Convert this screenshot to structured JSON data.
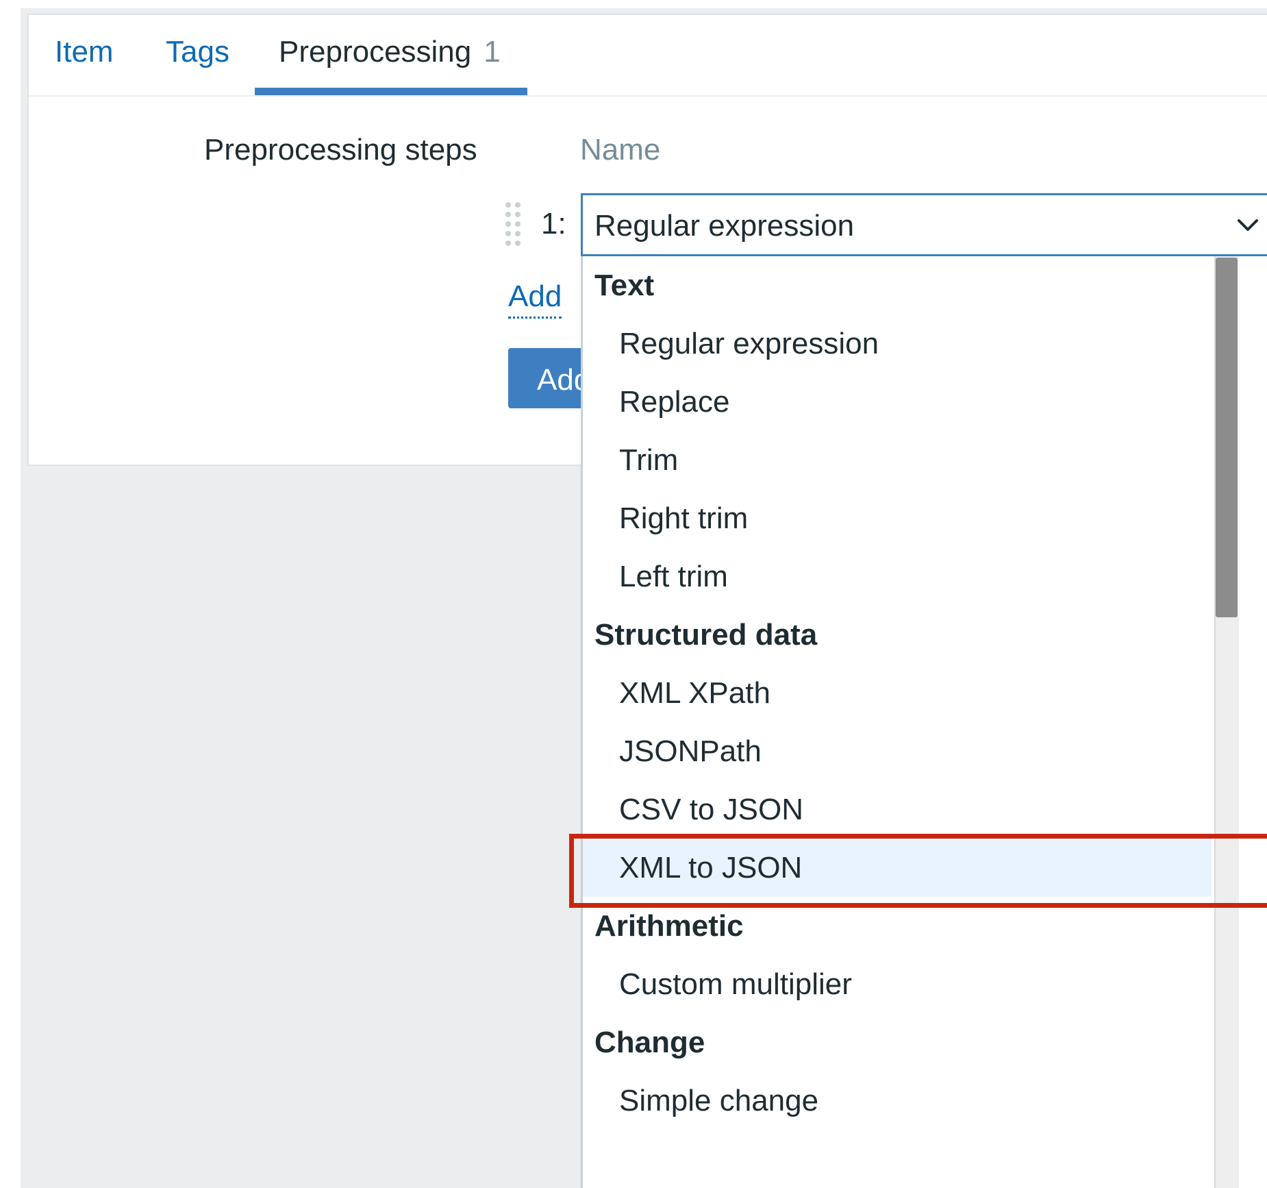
{
  "tabs": [
    {
      "label": "Item"
    },
    {
      "label": "Tags"
    },
    {
      "label": "Preprocessing",
      "count": "1"
    }
  ],
  "form": {
    "steps_label": "Preprocessing steps",
    "name_header": "Name",
    "step": {
      "number": "1:",
      "selected": "Regular expression"
    },
    "add_link": "Add",
    "add_button": "Add"
  },
  "dropdown": {
    "groups": [
      {
        "label": "Text",
        "options": [
          "Regular expression",
          "Replace",
          "Trim",
          "Right trim",
          "Left trim"
        ]
      },
      {
        "label": "Structured data",
        "options": [
          "XML XPath",
          "JSONPath",
          "CSV to JSON",
          "XML to JSON"
        ]
      },
      {
        "label": "Arithmetic",
        "options": [
          "Custom multiplier"
        ]
      },
      {
        "label": "Change",
        "options": [
          "Simple change"
        ]
      }
    ],
    "hovered_option": "XML to JSON"
  },
  "colors": {
    "accent": "#3e7fc1",
    "link": "#0f6ab4",
    "highlight_border": "#c8260f",
    "hover_background": "#e8f3fd"
  }
}
